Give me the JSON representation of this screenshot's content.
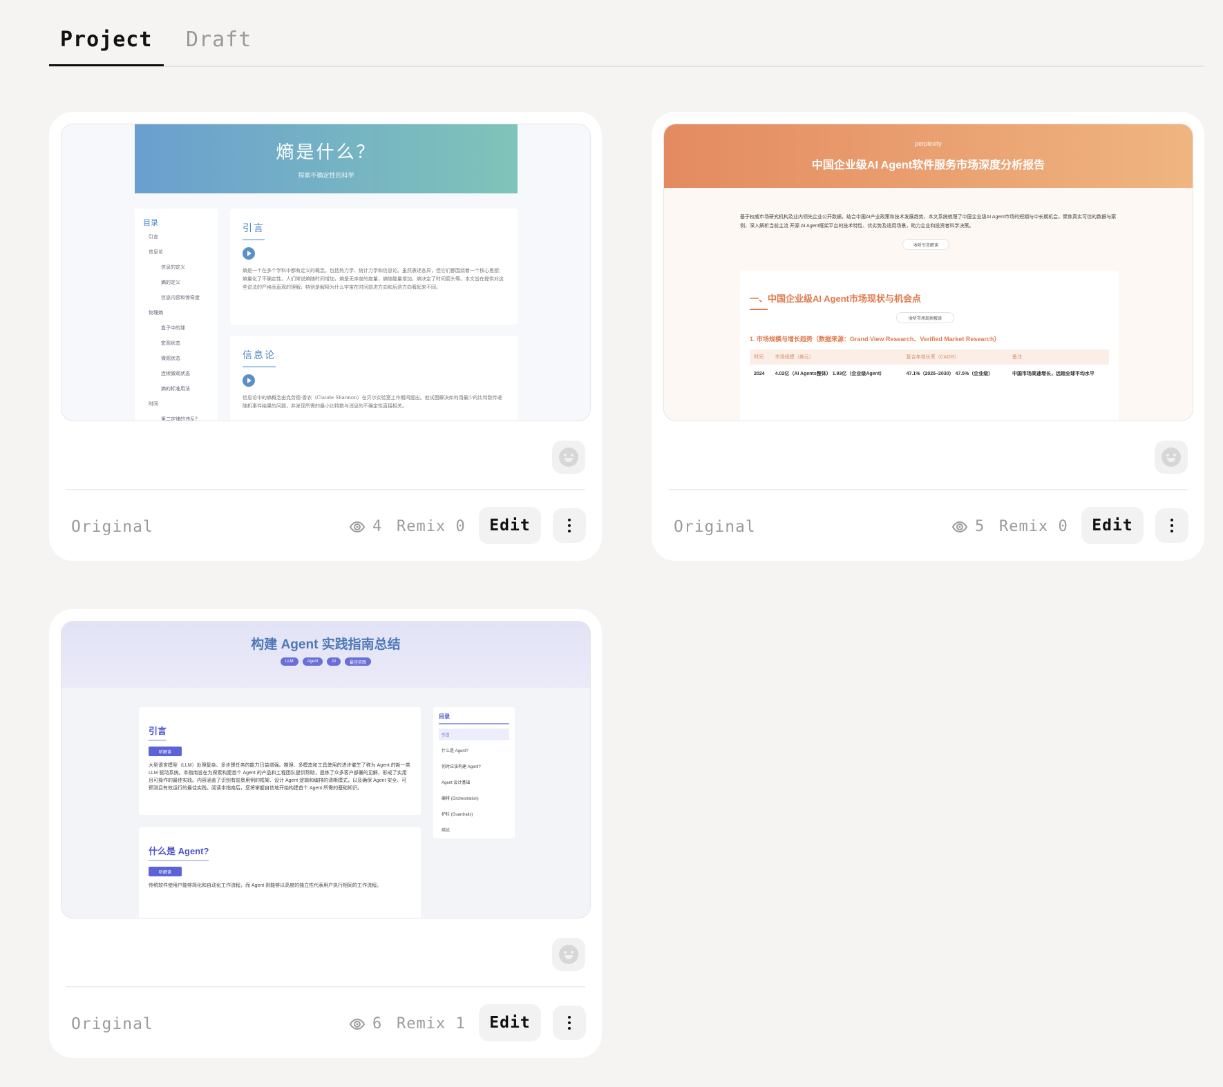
{
  "tabs": [
    {
      "label": "Project",
      "active": true
    },
    {
      "label": "Draft",
      "active": false
    }
  ],
  "cards": [
    {
      "original_label": "Original",
      "views": "4",
      "remix_label": "Remix 0",
      "edit_label": "Edit",
      "preview": {
        "title": "熵是什么？",
        "subtitle": "探索不确定性的科学",
        "toc_heading": "目录",
        "toc_items": [
          "引言",
          "信息论",
          "信息的定义",
          "熵的定义",
          "信息内容和惊奇度",
          "物理熵",
          "盒子中的球",
          "宏观状态",
          "微观状态",
          "连续微观状态",
          "熵的标准用法",
          "时间",
          "第二定律的违反?"
        ],
        "sections": [
          {
            "heading": "引言",
            "text": "熵是一个在多个学科中都有定义的概念。包括热力学、统计力学和信息论。虽然表述各异，但它们都围绕着一个核心思想：熵量化了不确定性。人们常说熵随时间增加，熵是无序度的度量，熵随能量增加，熵决定了时间箭头等。本文旨在提供对这些说法的严格而直观的理解，特别是解释为什么宇宙在时间前进方向和后退方向看起来不同。"
          },
          {
            "heading": "信息论",
            "text": "信息论中的熵概念由克劳德·香农（Claude Shannon）在贝尔实验室工作期间提出。他试图解决如何用最少的比特数传递随机事件结果的问题，并发现所需的最小比特数与消息的不确定性直接相关。"
          }
        ]
      }
    },
    {
      "original_label": "Original",
      "views": "5",
      "remix_label": "Remix 0",
      "edit_label": "Edit",
      "preview": {
        "brand": "perplexity",
        "title": "中国企业级AI Agent软件服务市场深度分析报告",
        "intro": "基于权威市场研究机构及业内领先企业公开数据，结合中国AI产业政策和技术发展趋势，本文系统梳理了中国企业级AI Agent市场的短期与中长期机会，聚焦真实可信的数据与案例，深入解析当前主流 开源 AI Agent框架平台的技术特性、优劣势及适用场景，助力企业和投资者科学决策。",
        "listen_intro": "收听引言解读",
        "section_heading": "一、中国企业级AI Agent市场现状与机会点",
        "listen_section": "收听市场现状解读",
        "subheading": "1. 市场规模与增长趋势（数据来源：Grand View Research、Verified Market Research）",
        "table_headers": [
          "时间",
          "市场规模（美元）",
          "复合年增长率（CAGR）",
          "备注"
        ],
        "table_rows": [
          [
            "2024",
            "4.02亿（AI Agents整体） 1.93亿（企业级Agent）",
            "47.1%（2025–2030） 47.5%（企业级）",
            "中国市场高速增长，远超全球平均水平"
          ]
        ]
      }
    },
    {
      "original_label": "Original",
      "views": "6",
      "remix_label": "Remix 1",
      "edit_label": "Edit",
      "preview": {
        "title": "构建 Agent 实践指南总结",
        "tags": [
          "LLM",
          "Agent",
          "AI",
          "最佳实践"
        ],
        "listen_label": "听解读",
        "sections": [
          {
            "heading": "引言",
            "text": "大型语言模型（LLM）处理复杂、多步骤任务的能力日益增强。推理、多模态和工具使用的进步催生了称为 Agent 的新一类 LLM 驱动系统。本指南旨在为探索构建首个 Agent 的产品和工程团队提供帮助，提炼了众多客户部署的见解，形成了实用且可操作的最佳实践。内容涵盖了识别有前景用例的框架、设计 Agent 逻辑和编排的清晰模式，以及确保 Agent 安全、可预测且有效运行的最佳实践。阅读本指南后，您将掌握自信地开始构建首个 Agent 所需的基础知识。"
          },
          {
            "heading": "什么是 Agent?",
            "text": "传统软件使用户能够简化和自动化工作流程，而 Agent 则能够以高度的独立性代表用户执行相同的工作流程。"
          }
        ],
        "toc_heading": "目录",
        "toc_items": [
          "引言",
          "什么是 Agent?",
          "何时应该构建 Agent?",
          "Agent 设计基础",
          "编排 (Orchestration)",
          "护栏 (Guardrails)",
          "结论"
        ]
      }
    }
  ]
}
